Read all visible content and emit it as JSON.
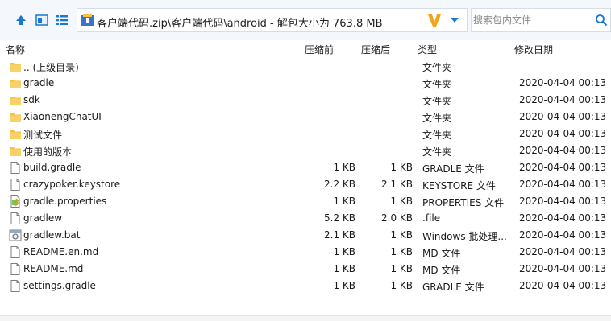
{
  "toolbar": {
    "up_icon": "up-arrow-icon",
    "view_icon": "view-mode-icon",
    "list_icon": "list-view-icon",
    "path": "客户端代码.zip\\客户端代码\\android - 解包大小为 763.8 MB",
    "search_placeholder": "搜索包内文件"
  },
  "columns": {
    "name": "名称",
    "compressed": "压缩前",
    "original": "压缩后",
    "type": "类型",
    "modified": "修改日期"
  },
  "colors": {
    "folder": "#f5c242",
    "accent": "#1a78d2",
    "v_logo": "#f2a51a"
  },
  "files": [
    {
      "icon": "folder",
      "name": ".. (上级目录)",
      "csize": "",
      "osize": "",
      "type": "文件夹",
      "date": ""
    },
    {
      "icon": "folder",
      "name": "gradle",
      "csize": "",
      "osize": "",
      "type": "文件夹",
      "date": "2020-04-04 00:13"
    },
    {
      "icon": "folder",
      "name": "sdk",
      "csize": "",
      "osize": "",
      "type": "文件夹",
      "date": "2020-04-04 00:13"
    },
    {
      "icon": "folder",
      "name": "XiaonengChatUI",
      "csize": "",
      "osize": "",
      "type": "文件夹",
      "date": "2020-04-04 00:13"
    },
    {
      "icon": "folder",
      "name": "测试文件",
      "csize": "",
      "osize": "",
      "type": "文件夹",
      "date": "2020-04-04 00:13"
    },
    {
      "icon": "folder",
      "name": "使用的版本",
      "csize": "",
      "osize": "",
      "type": "文件夹",
      "date": "2020-04-04 00:13"
    },
    {
      "icon": "file",
      "name": "build.gradle",
      "csize": "1 KB",
      "osize": "1 KB",
      "type": "GRADLE 文件",
      "date": "2020-04-04 00:13"
    },
    {
      "icon": "file",
      "name": "crazypoker.keystore",
      "csize": "2.2 KB",
      "osize": "2.1 KB",
      "type": "KEYSTORE 文件",
      "date": "2020-04-04 00:13"
    },
    {
      "icon": "props",
      "name": "gradle.properties",
      "csize": "1 KB",
      "osize": "1 KB",
      "type": "PROPERTIES 文件",
      "date": "2020-04-04 00:13"
    },
    {
      "icon": "file",
      "name": "gradlew",
      "csize": "5.2 KB",
      "osize": "2.0 KB",
      "type": ".file",
      "date": "2020-04-04 00:13"
    },
    {
      "icon": "bat",
      "name": "gradlew.bat",
      "csize": "2.1 KB",
      "osize": "1 KB",
      "type": "Windows 批处理...",
      "date": "2020-04-04 00:13"
    },
    {
      "icon": "file",
      "name": "README.en.md",
      "csize": "1 KB",
      "osize": "1 KB",
      "type": "MD 文件",
      "date": "2020-04-04 00:13"
    },
    {
      "icon": "file",
      "name": "README.md",
      "csize": "1 KB",
      "osize": "1 KB",
      "type": "MD 文件",
      "date": "2020-04-04 00:13"
    },
    {
      "icon": "file",
      "name": "settings.gradle",
      "csize": "1 KB",
      "osize": "1 KB",
      "type": "GRADLE 文件",
      "date": "2020-04-04 00:13"
    }
  ]
}
